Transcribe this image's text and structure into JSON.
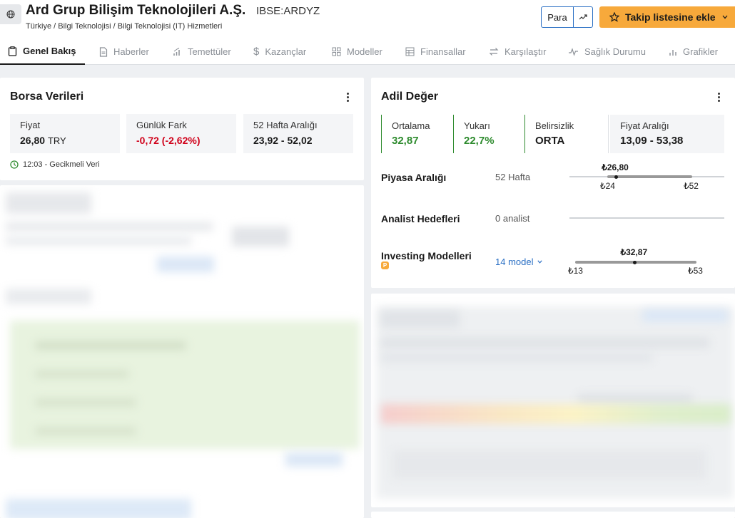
{
  "header": {
    "company": "Ard Grup Bilişim Teknolojileri A.Ş.",
    "ticker": "IBSE:ARDYZ",
    "breadcrumb": "Türkiye / Bilgi Teknolojisi / Bilgi Teknolojisi (IT) Hizmetleri",
    "currency_button": "Para",
    "watchlist_button": "Takip listesine ekle"
  },
  "tabs": [
    {
      "label": "Genel Bakış"
    },
    {
      "label": "Haberler"
    },
    {
      "label": "Temettüler"
    },
    {
      "label": "Kazançlar"
    },
    {
      "label": "Modeller"
    },
    {
      "label": "Finansallar"
    },
    {
      "label": "Karşılaştır"
    },
    {
      "label": "Sağlık Durumu"
    },
    {
      "label": "Grafikler"
    }
  ],
  "market_data": {
    "title": "Borsa Verileri",
    "price_label": "Fiyat",
    "price_value": "26,80",
    "price_unit": "TRY",
    "change_label": "Günlük Fark",
    "change_value": "-0,72 (-2,62%)",
    "range_label": "52 Hafta Aralığı",
    "range_value": "23,92 - 52,02",
    "delay_text": "12:03 - Gecikmeli Veri"
  },
  "fair_value": {
    "title": "Adil Değer",
    "avg_label": "Ortalama",
    "avg_value": "32,87",
    "upside_label": "Yukarı",
    "upside_value": "22,7%",
    "uncertainty_label": "Belirsizlik",
    "uncertainty_value": "ORTA",
    "price_range_label": "Fiyat Aralığı",
    "price_range_value": "13,09 - 53,38",
    "market_range": {
      "label": "Piyasa Aralığı",
      "sub": "52 Hafta",
      "current": "₺26,80",
      "low": "₺24",
      "high": "₺52",
      "low_value": 23.92,
      "high_value": 52.02,
      "current_value": 26.8
    },
    "analyst_targets": {
      "label": "Analist Hedefleri",
      "sub": "0 analist"
    },
    "investing_models": {
      "label": "Investing Modelleri",
      "sub": "14 model",
      "current": "₺32,87",
      "low": "₺13",
      "high": "₺53",
      "low_value": 13.09,
      "high_value": 53.38,
      "current_value": 32.87
    }
  },
  "colors": {
    "accent": "#f7a93b",
    "link": "#2a6fc4",
    "negative": "#d0021b",
    "positive": "#2e8b2e"
  }
}
